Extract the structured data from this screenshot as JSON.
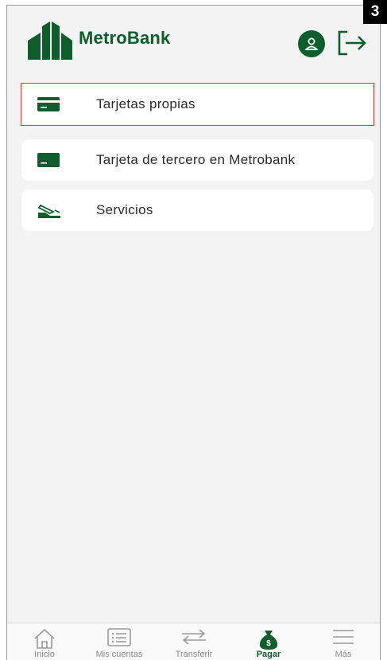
{
  "annotation": {
    "step": "3"
  },
  "header": {
    "brand": "MetroBank",
    "brand_color": "#0f5c2c"
  },
  "menu": {
    "items": [
      {
        "label": "Tarjetas propias",
        "icon": "credit-card-icon",
        "highlighted": true
      },
      {
        "label": "Tarjeta de tercero en Metrobank",
        "icon": "card-icon",
        "highlighted": false
      },
      {
        "label": "Servicios",
        "icon": "bill-hand-icon",
        "highlighted": false
      }
    ]
  },
  "bottom_nav": {
    "items": [
      {
        "label": "Inicio",
        "icon": "home-icon"
      },
      {
        "label": "Mis cuentas",
        "icon": "list-icon"
      },
      {
        "label": "Transferir",
        "icon": "transfer-icon"
      },
      {
        "label": "Pagar",
        "icon": "money-bag-icon",
        "active": true
      },
      {
        "label": "Más",
        "icon": "menu-icon"
      }
    ]
  }
}
